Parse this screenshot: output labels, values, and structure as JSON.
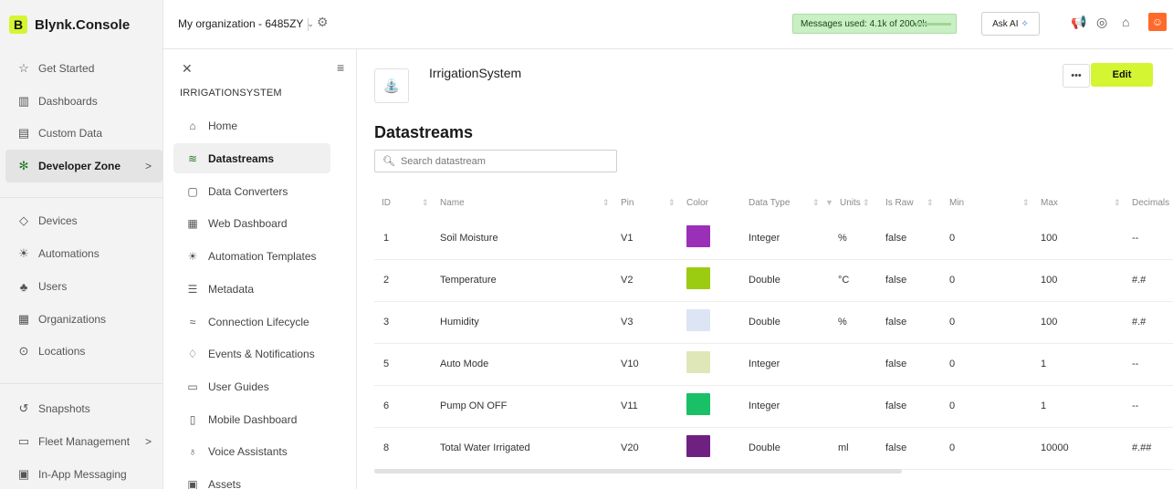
{
  "brand": {
    "logo": "B",
    "name": "Blynk.Console"
  },
  "nav": [
    {
      "label": "Get Started",
      "icon": "star-icon",
      "glyph": "☆"
    },
    {
      "label": "Dashboards",
      "icon": "dashboards-icon",
      "glyph": "▥"
    },
    {
      "label": "Custom Data",
      "icon": "database-icon",
      "glyph": "▤"
    },
    {
      "label": "Developer Zone",
      "icon": "developer-icon",
      "glyph": "✻",
      "chevron": ">"
    },
    {
      "label": "Devices",
      "icon": "devices-icon",
      "glyph": "◇"
    },
    {
      "label": "Automations",
      "icon": "automations-icon",
      "glyph": "☀"
    },
    {
      "label": "Users",
      "icon": "users-icon",
      "glyph": "♣"
    },
    {
      "label": "Organizations",
      "icon": "organizations-icon",
      "glyph": "▦"
    },
    {
      "label": "Locations",
      "icon": "location-icon",
      "glyph": "⊙"
    },
    {
      "label": "Snapshots",
      "icon": "snapshots-icon",
      "glyph": "↺"
    },
    {
      "label": "Fleet Management",
      "icon": "fleet-icon",
      "glyph": "▭",
      "chevron": ">"
    },
    {
      "label": "In-App Messaging",
      "icon": "messaging-icon",
      "glyph": "▣"
    }
  ],
  "topbar": {
    "org": "My organization - 6485ZY",
    "org_caret": "⌄",
    "messages_used": "Messages used: 4.1k of 200.0k",
    "messages_fraction": 0.0205,
    "ask_ai": "Ask AI"
  },
  "sub": {
    "title": "IRRIGATIONSYSTEM",
    "items": [
      {
        "label": "Home",
        "icon": "home-icon",
        "glyph": "⌂"
      },
      {
        "label": "Datastreams",
        "icon": "datastreams-icon",
        "glyph": "≋"
      },
      {
        "label": "Data Converters",
        "icon": "converters-icon",
        "glyph": "▢"
      },
      {
        "label": "Web Dashboard",
        "icon": "web-dashboard-icon",
        "glyph": "▦"
      },
      {
        "label": "Automation Templates",
        "icon": "automation-templates-icon",
        "glyph": "☀"
      },
      {
        "label": "Metadata",
        "icon": "metadata-icon",
        "glyph": "☰"
      },
      {
        "label": "Connection Lifecycle",
        "icon": "wifi-icon",
        "glyph": "≈"
      },
      {
        "label": "Events & Notifications",
        "icon": "bell-icon",
        "glyph": "♢"
      },
      {
        "label": "User Guides",
        "icon": "book-icon",
        "glyph": "▭"
      },
      {
        "label": "Mobile Dashboard",
        "icon": "mobile-icon",
        "glyph": "▯"
      },
      {
        "label": "Voice Assistants",
        "icon": "microphone-icon",
        "glyph": "♁"
      },
      {
        "label": "Assets",
        "icon": "assets-icon",
        "glyph": "▣"
      }
    ]
  },
  "main": {
    "template_name": "IrrigationSystem",
    "more": "•••",
    "edit": "Edit",
    "section_title": "Datastreams",
    "search_placeholder": "Search datastream",
    "columns": [
      "ID",
      "Name",
      "Pin",
      "Color",
      "Data Type",
      "Units",
      "Is Raw",
      "Min",
      "Max",
      "Decimals"
    ],
    "rows": [
      {
        "id": "1",
        "name": "Soil Moisture",
        "pin": "V1",
        "color": "#9b30b8",
        "type": "Integer",
        "units": "%",
        "raw": "false",
        "min": "0",
        "max": "100",
        "decimals": "--"
      },
      {
        "id": "2",
        "name": "Temperature",
        "pin": "V2",
        "color": "#9ccc12",
        "type": "Double",
        "units": "°C",
        "raw": "false",
        "min": "0",
        "max": "100",
        "decimals": "#.#"
      },
      {
        "id": "3",
        "name": "Humidity",
        "pin": "V3",
        "color": "#dde4f3",
        "type": "Double",
        "units": "%",
        "raw": "false",
        "min": "0",
        "max": "100",
        "decimals": "#.#"
      },
      {
        "id": "5",
        "name": "Auto Mode",
        "pin": "V10",
        "color": "#dfe7b8",
        "type": "Integer",
        "units": "",
        "raw": "false",
        "min": "0",
        "max": "1",
        "decimals": "--"
      },
      {
        "id": "6",
        "name": "Pump ON OFF",
        "pin": "V11",
        "color": "#19c066",
        "type": "Integer",
        "units": "",
        "raw": "false",
        "min": "0",
        "max": "1",
        "decimals": "--"
      },
      {
        "id": "8",
        "name": "Total Water Irrigated",
        "pin": "V20",
        "color": "#6f2182",
        "type": "Double",
        "units": "ml",
        "raw": "false",
        "min": "0",
        "max": "10000",
        "decimals": "#.##"
      }
    ]
  }
}
